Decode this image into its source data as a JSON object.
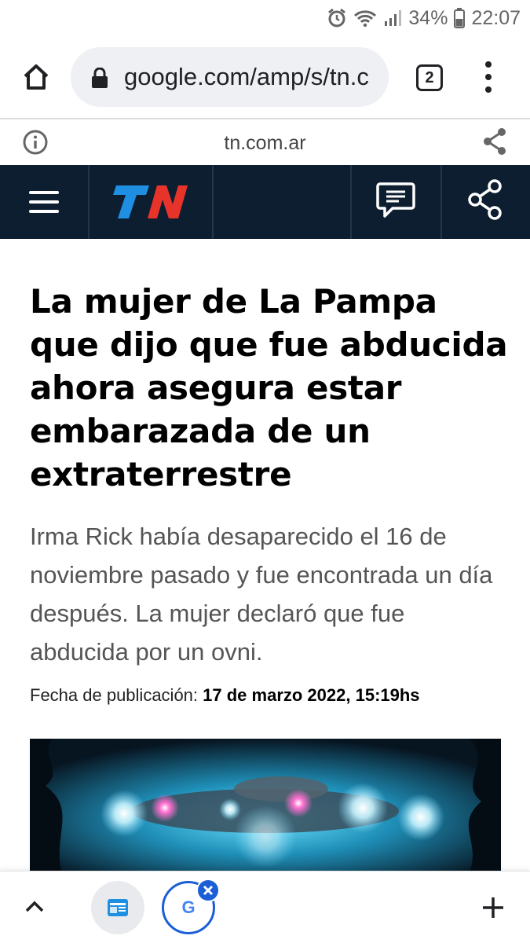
{
  "status_bar": {
    "battery": "34%",
    "time": "22:07",
    "icons": [
      "alarm-icon",
      "wifi-icon",
      "signal-icon",
      "battery-icon"
    ]
  },
  "browser": {
    "url": "google.com/amp/s/tn.c",
    "tab_count": "2",
    "icons": [
      "home-icon",
      "lock-icon",
      "tab-switcher-icon",
      "more-vert-icon"
    ]
  },
  "amp_bar": {
    "domain": "tn.com.ar",
    "icons": [
      "info-icon",
      "share-icon"
    ]
  },
  "site_header": {
    "logo_text": "TN",
    "brand_colors": {
      "background": "#0e1e31",
      "logo_blue": "#1e8fe1",
      "logo_red": "#e8332a"
    },
    "icons": [
      "hamburger-menu-icon",
      "comment-icon",
      "share-icon"
    ]
  },
  "article": {
    "headline": "La mujer de La Pampa que dijo que fue abducida ahora asegura estar embarazada de un extraterrestre",
    "subtitle": "Irma Rick había desaparecido el 16 de noviembre pasado y fue encontrada un día después. La mujer declaró que fue abducida por un ovni.",
    "pub_label": "Fecha de publicación:",
    "pub_date": "17 de marzo 2022, 15:19hs"
  },
  "bottom_bar": {
    "google_glyph": "G",
    "icons": [
      "chevron-up-icon",
      "tab-thumbnail-icon",
      "google-icon",
      "close-icon",
      "plus-icon"
    ]
  }
}
